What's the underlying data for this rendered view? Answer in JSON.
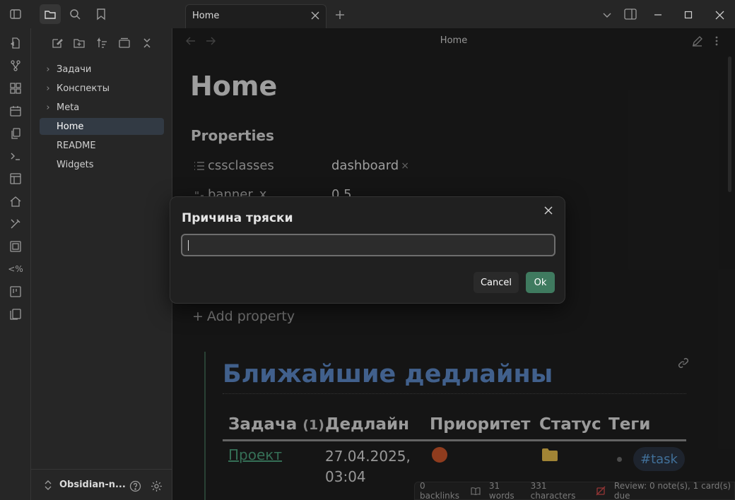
{
  "tabs": [
    {
      "label": "Home"
    }
  ],
  "sidebar": {
    "items": [
      {
        "label": "Задачи",
        "folder": true
      },
      {
        "label": "Конспекты",
        "folder": true
      },
      {
        "label": "Meta",
        "folder": true
      },
      {
        "label": "Home",
        "folder": false,
        "active": true
      },
      {
        "label": "README",
        "folder": false
      },
      {
        "label": "Widgets",
        "folder": false
      }
    ],
    "vault_name": "Obsidian-n..."
  },
  "header": {
    "title": "Home"
  },
  "note": {
    "title": "Home",
    "properties_heading": "Properties",
    "properties": [
      {
        "key": "cssclasses",
        "value": "dashboard"
      },
      {
        "key": "banner_x",
        "value": "0.5"
      }
    ],
    "add_property": "Add property",
    "section_heading": "Ближайшие дедлайны",
    "table": {
      "headers": [
        "Задача",
        "(1)",
        "Дедлайн",
        "Приоритет",
        "Статус",
        "Теги"
      ],
      "rows": [
        {
          "task": "Проект",
          "deadline_line1": "27.04.2025,",
          "deadline_line2": "03:04",
          "tag": "#task"
        }
      ]
    }
  },
  "modal": {
    "title": "Причина тряски",
    "input_value": "",
    "cancel_label": "Cancel",
    "ok_label": "Ok"
  },
  "status_bar": {
    "backlinks": "0 backlinks",
    "words": "31 words",
    "characters": "331 characters",
    "review": "Review: 0 note(s), 1 card(s) due"
  },
  "colors": {
    "accent_green": "#3f7a5f",
    "heading_blue": "#5a86c2",
    "tag_blue": "#5a9bd5",
    "priority_orange": "#c7542a",
    "folder_yellow": "#e0b84a"
  }
}
